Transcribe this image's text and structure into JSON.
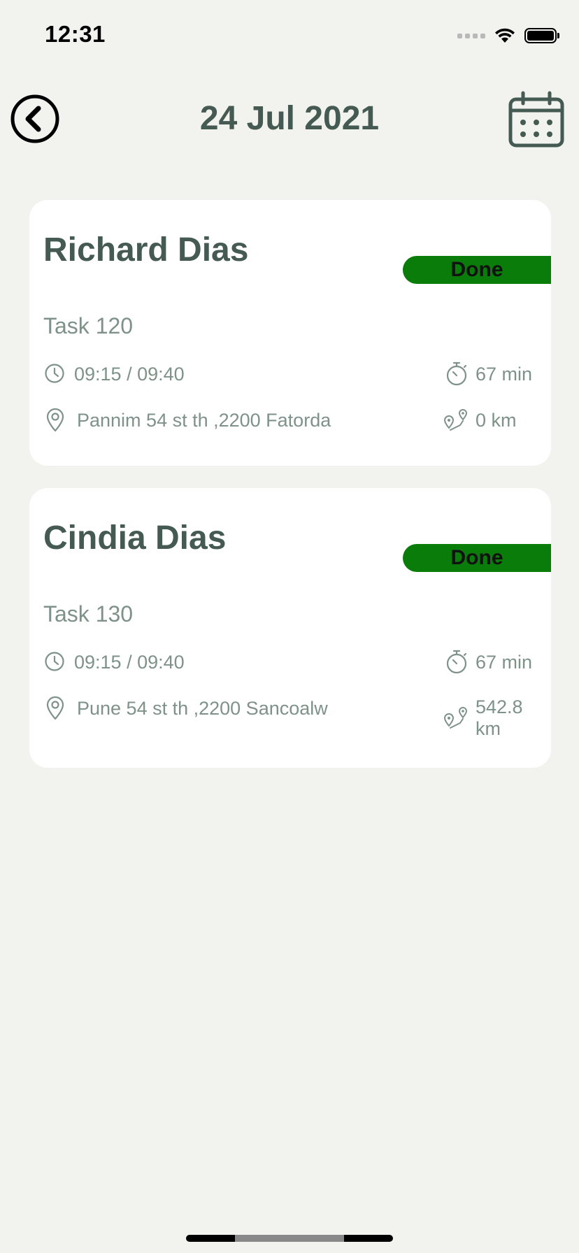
{
  "status_bar": {
    "time": "12:31"
  },
  "header": {
    "title": "24 Jul 2021"
  },
  "tasks": [
    {
      "name": "Richard Dias",
      "status": "Done",
      "task": "Task 120",
      "time_range": "09:15 / 09:40",
      "duration": "67 min",
      "address": "Pannim 54 st th ,2200 Fatorda",
      "distance": "0 km"
    },
    {
      "name": "Cindia Dias",
      "status": "Done",
      "task": "Task 130",
      "time_range": "09:15 / 09:40",
      "duration": "67 min",
      "address": "Pune 54 st th ,2200 Sancoalw",
      "distance": "542.8 km"
    }
  ],
  "colors": {
    "background": "#f2f2ef",
    "card": "#ffffff",
    "title": "#455a52",
    "muted": "#7e928a",
    "done_badge": "#0a7c0a"
  },
  "icons": {
    "back": "chevron-left-circle-icon",
    "calendar": "calendar-icon",
    "time": "clock-icon",
    "duration": "stopwatch-icon",
    "address": "map-pin-icon",
    "distance": "route-icon"
  }
}
